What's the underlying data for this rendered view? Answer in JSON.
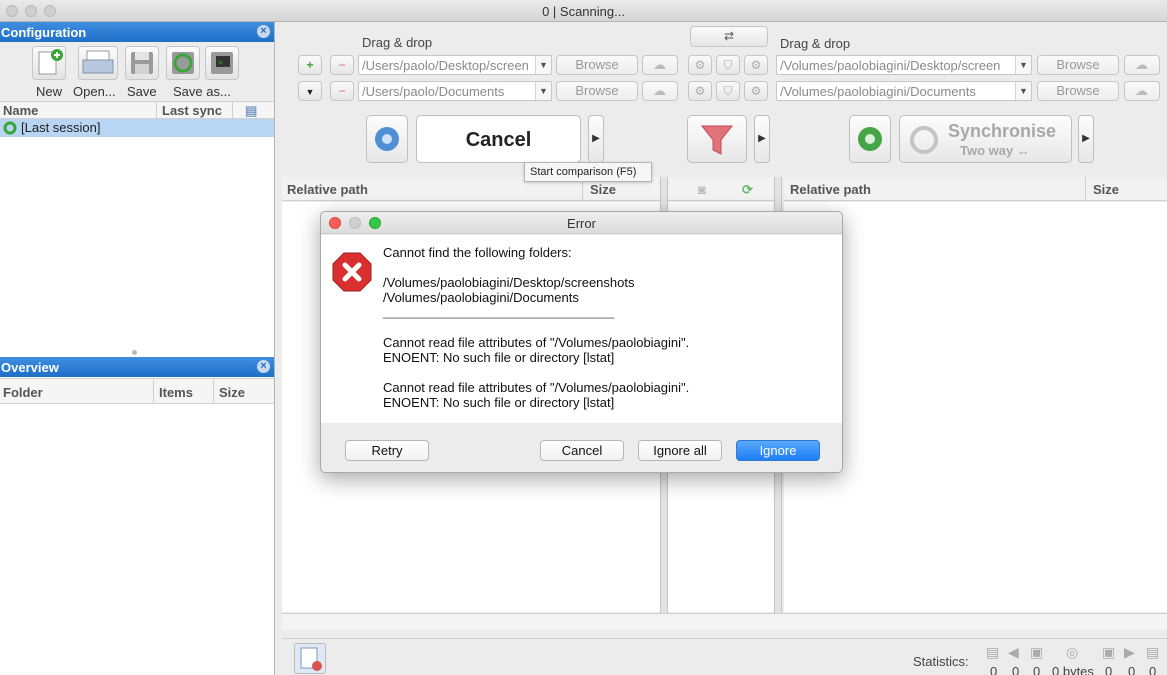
{
  "window": {
    "title": "0 | Scanning..."
  },
  "config_panel": {
    "header": "Configuration",
    "toolbar": [
      {
        "label": "New",
        "icon": "new-file-icon"
      },
      {
        "label": "Open...",
        "icon": "open-printer-icon"
      },
      {
        "label": "Save",
        "icon": "save-disk-icon"
      },
      {
        "label": "Save as...",
        "icon": "save-as-icon"
      }
    ],
    "columns": {
      "name": "Name",
      "last_sync": "Last sync"
    },
    "sessions": [
      "[Last session]"
    ]
  },
  "overview_panel": {
    "header": "Overview",
    "columns": {
      "folder": "Folder",
      "items": "Items",
      "size": "Size"
    }
  },
  "folders": {
    "left_label": "Drag & drop",
    "right_label": "Drag & drop",
    "left_paths": [
      "/Users/paolo/Desktop/screen",
      "/Users/paolo/Documents"
    ],
    "right_paths": [
      "/Volumes/paolobiagini/Desktop/screen",
      "/Volumes/paolobiagini/Documents"
    ],
    "browse_label": "Browse"
  },
  "actions": {
    "cancel_label": "Cancel",
    "sync_label": "Synchronise",
    "sync_sub": "Two way ↔",
    "tooltip": "Start comparison (F5)"
  },
  "grid": {
    "left": {
      "path": "Relative path",
      "size": "Size"
    },
    "right": {
      "path": "Relative path",
      "size": "Size"
    }
  },
  "status": {
    "statistics_label": "Statistics:",
    "values": [
      "0",
      "0",
      "0",
      "0 bytes",
      "0",
      "0",
      "0"
    ]
  },
  "dialog": {
    "title": "Error",
    "heading": "Cannot find the following folders:",
    "folders": [
      "/Volumes/paolobiagini/Desktop/screenshots",
      "/Volumes/paolobiagini/Documents"
    ],
    "separator": "________________________________",
    "error1_line1": "Cannot read file attributes of \"/Volumes/paolobiagini\".",
    "error1_line2": "ENOENT: No such file or directory [lstat]",
    "error2_line1": "Cannot read file attributes of \"/Volumes/paolobiagini\".",
    "error2_line2": "ENOENT: No such file or directory [lstat]",
    "buttons": {
      "retry": "Retry",
      "cancel": "Cancel",
      "ignore_all": "Ignore all",
      "ignore": "Ignore"
    }
  },
  "colors": {
    "accent": "#1f6fc8",
    "selection": "#b8d6f4",
    "primary_button": "#1d7ef7",
    "error": "#d9302f"
  }
}
